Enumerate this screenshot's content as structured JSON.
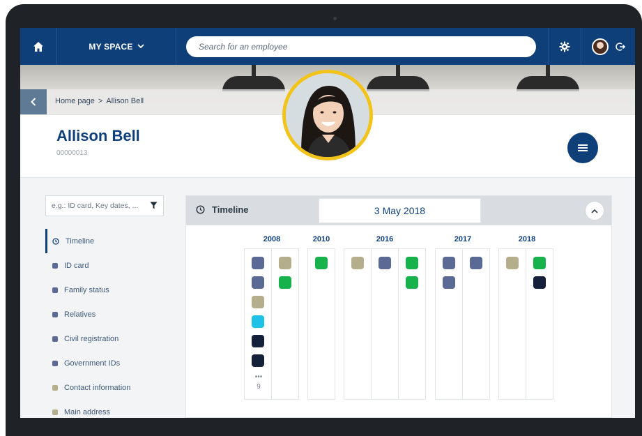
{
  "topbar": {
    "home_icon": "home-icon",
    "myspace_label": "MY SPACE",
    "search_placeholder": "Search for an employee",
    "settings_icon": "gear-icon",
    "logout_icon": "logout-icon"
  },
  "breadcrumb": {
    "home": "Home page",
    "separator": ">",
    "current": "Allison Bell"
  },
  "profile": {
    "name": "Allison Bell",
    "employee_id": "00000013"
  },
  "filter": {
    "placeholder": "e.g.: ID card, Key dates, ..."
  },
  "sidebar": {
    "items": [
      {
        "label": "Timeline",
        "icon": "clock-icon",
        "color": "#0f3f78"
      },
      {
        "label": "ID card",
        "color": "#5a6a95"
      },
      {
        "label": "Family status",
        "color": "#5a6a95"
      },
      {
        "label": "Relatives",
        "color": "#5a6a95"
      },
      {
        "label": "Civil registration",
        "color": "#5a6a95"
      },
      {
        "label": "Government IDs",
        "color": "#5a6a95"
      },
      {
        "label": "Contact information",
        "color": "#b5ae8c"
      },
      {
        "label": "Main address",
        "color": "#b5ae8c"
      }
    ]
  },
  "timeline": {
    "title": "Timeline",
    "date": "3 May 2018",
    "years": [
      "2008",
      "2010",
      "2016",
      "2017",
      "2018"
    ],
    "more_count": "9",
    "colors": {
      "slate": "#5a6a95",
      "khaki": "#b5ae8c",
      "green": "#17b24c",
      "cyan": "#1fc2e6",
      "navy": "#15213a"
    }
  }
}
